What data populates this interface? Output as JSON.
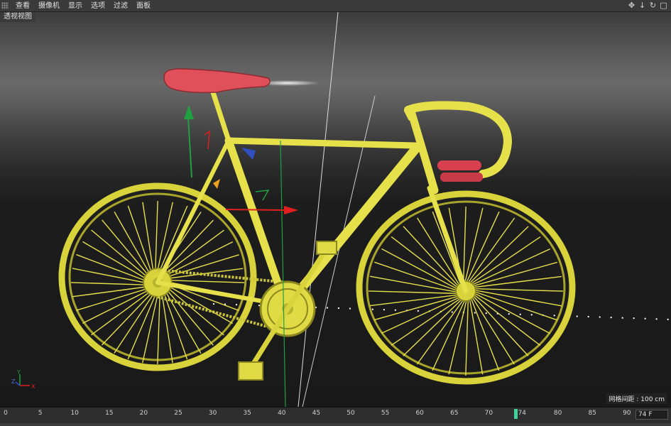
{
  "menu": {
    "items": [
      {
        "label": "查看"
      },
      {
        "label": "摄像机"
      },
      {
        "label": "显示"
      },
      {
        "label": "选项"
      },
      {
        "label": "过滤"
      },
      {
        "label": "面板"
      }
    ],
    "nav_icons": [
      "move-icon",
      "down-arrow-icon",
      "rotate-icon",
      "maximize-icon"
    ]
  },
  "viewport": {
    "label": "透视视图",
    "grid_info": "网格间距 : 100 cm"
  },
  "axis_gizmo": {
    "x": "X",
    "y": "Y",
    "z": "Z"
  },
  "timeline": {
    "ticks": [
      "0",
      "5",
      "10",
      "15",
      "20",
      "25",
      "30",
      "35",
      "40",
      "45",
      "50",
      "55",
      "60",
      "65",
      "70",
      "74",
      "80",
      "85",
      "90"
    ],
    "current_frame": 74,
    "frame_field": "74 F"
  },
  "colors": {
    "frame": "#e6e14a",
    "saddle": "#e0505a",
    "grip": "#d84050",
    "x_axis": "#e02020",
    "y_axis": "#20a040",
    "z_axis": "#3050c0",
    "marker": "#3fd39a"
  }
}
